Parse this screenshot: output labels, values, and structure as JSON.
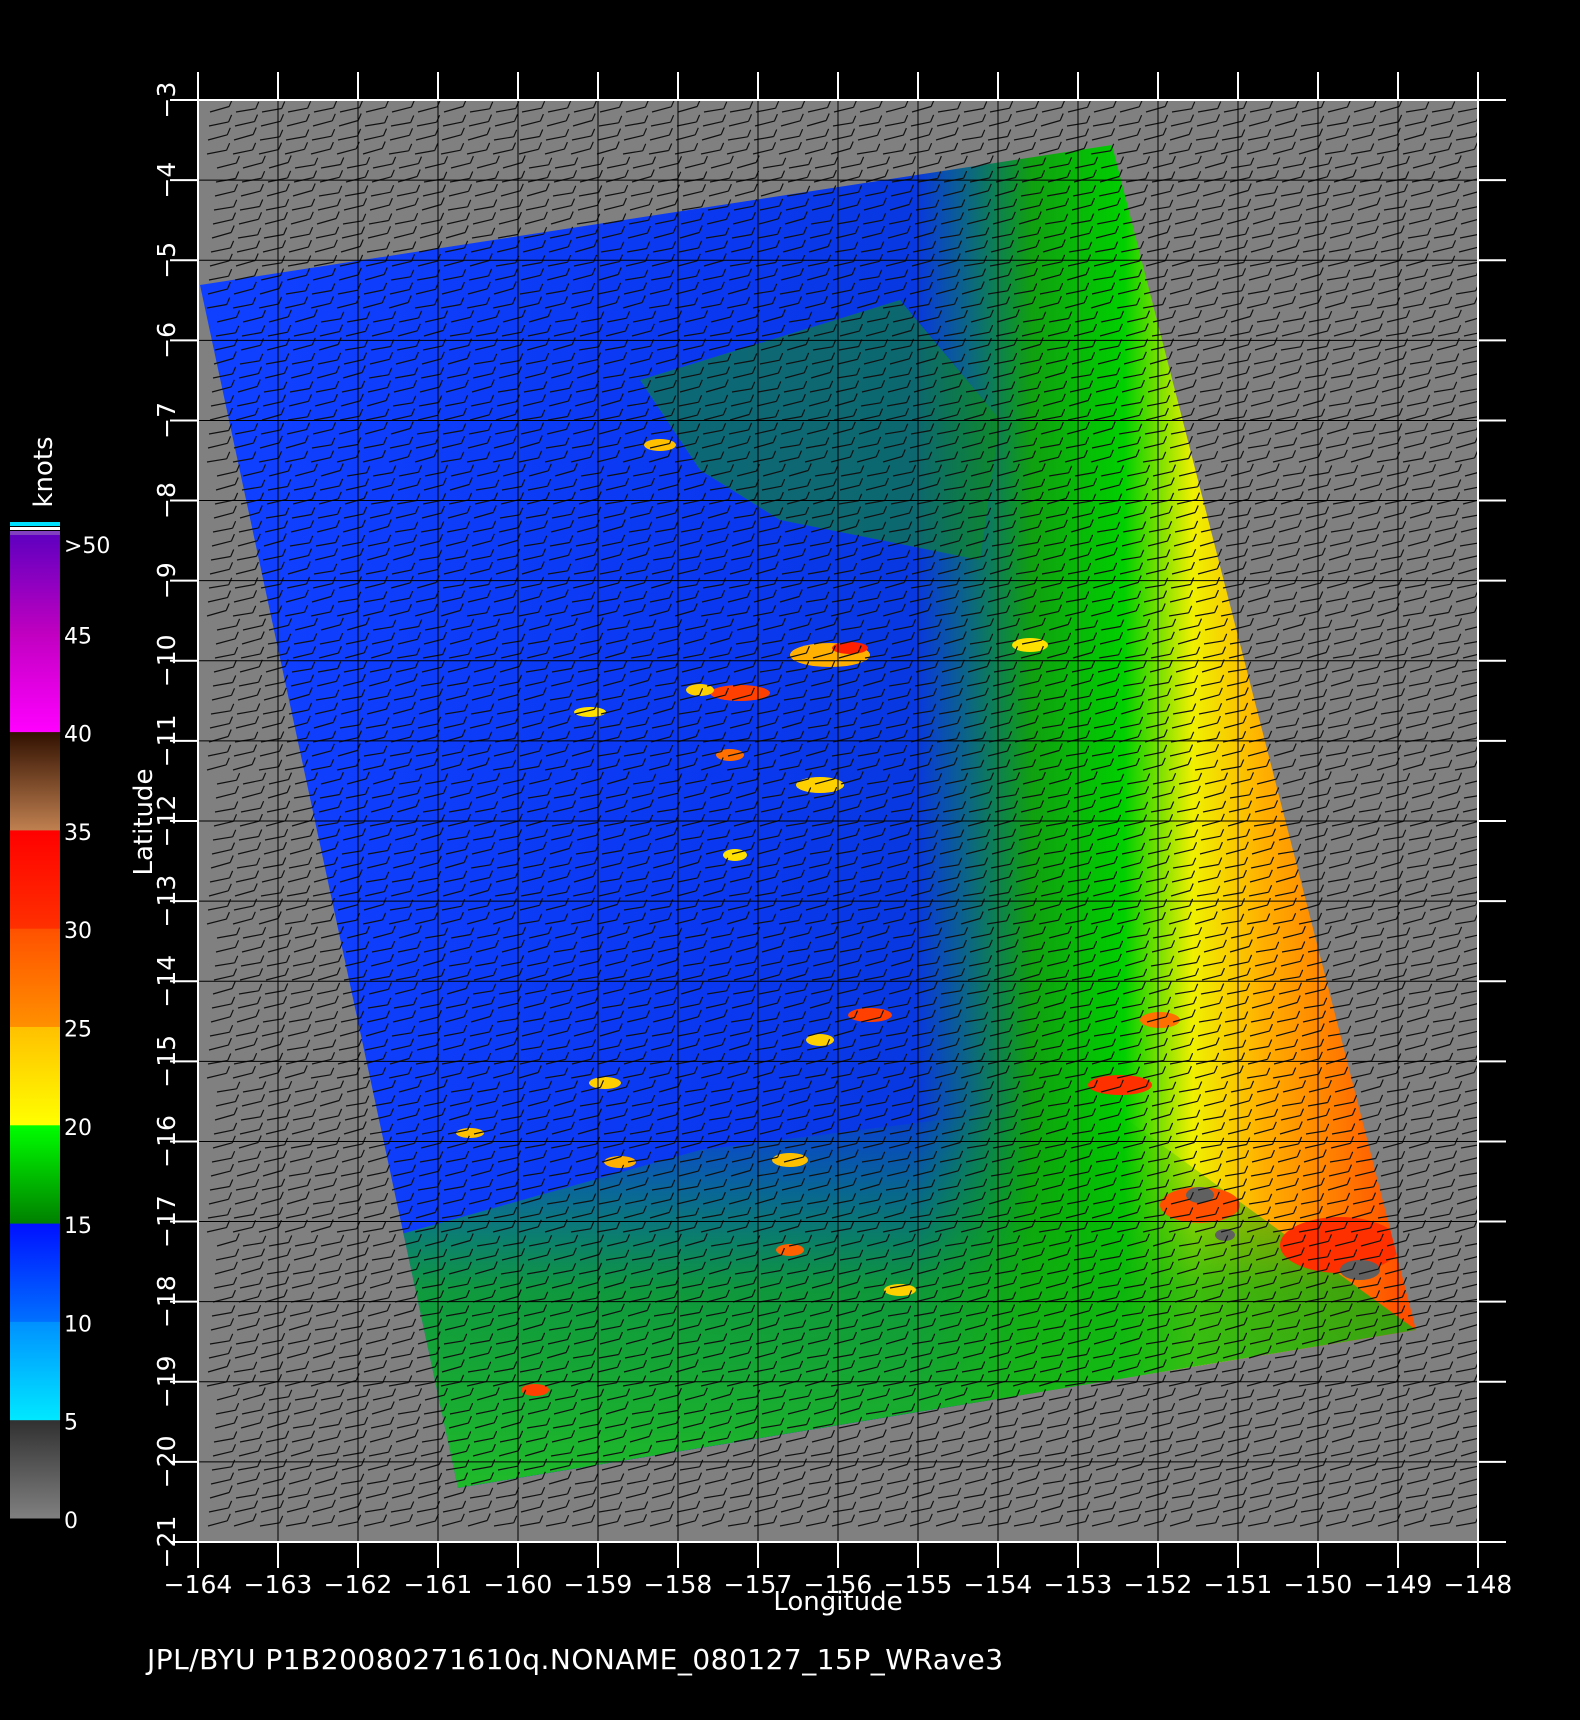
{
  "map": {
    "x_label": "Longitude",
    "y_label": "Latitude",
    "x_ticks": [
      "−164",
      "−163",
      "−162",
      "−161",
      "−160",
      "−159",
      "−158",
      "−157",
      "−156",
      "−155",
      "−154",
      "−153",
      "−152",
      "−151",
      "−150",
      "−149",
      "−148"
    ],
    "y_ticks": [
      "−3",
      "−4",
      "−5",
      "−6",
      "−7",
      "−8",
      "−9",
      "−10",
      "−11",
      "−12",
      "−13",
      "−14",
      "−15",
      "−16",
      "−17",
      "−18",
      "−19",
      "−20",
      "−21"
    ],
    "lon_range": [
      -164,
      -148
    ],
    "lat_range": [
      -21,
      -3
    ],
    "background_color": "#808080"
  },
  "colorbar": {
    "unit": "knots",
    "labels": [
      ">50",
      "45",
      "40",
      "35",
      "30",
      "25",
      "20",
      "15",
      "10",
      "5",
      "0"
    ],
    "bands": [
      {
        "range": [
          0,
          5
        ],
        "colors": [
          "#808080",
          "#303030"
        ]
      },
      {
        "range": [
          5,
          10
        ],
        "colors": [
          "#00e8ff",
          "#0090ff"
        ]
      },
      {
        "range": [
          10,
          15
        ],
        "colors": [
          "#0070ff",
          "#0010ff"
        ]
      },
      {
        "range": [
          15,
          20
        ],
        "colors": [
          "#008000",
          "#00ff00"
        ]
      },
      {
        "range": [
          20,
          25
        ],
        "colors": [
          "#ffff00",
          "#ffc000"
        ]
      },
      {
        "range": [
          25,
          30
        ],
        "colors": [
          "#ff9000",
          "#ff5000"
        ]
      },
      {
        "range": [
          30,
          35
        ],
        "colors": [
          "#ff3000",
          "#ff0000"
        ]
      },
      {
        "range": [
          35,
          40
        ],
        "colors": [
          "#c08050",
          "#301000"
        ]
      },
      {
        "range": [
          40,
          45
        ],
        "colors": [
          "#ff00ff",
          "#c000c0"
        ]
      },
      {
        "range": [
          45,
          50
        ],
        "colors": [
          "#c000c0",
          "#6000c0"
        ]
      }
    ]
  },
  "footer": {
    "caption": "JPL/BYU  P1B20080271610q.NONAME_080127_15P_WRave3"
  }
}
